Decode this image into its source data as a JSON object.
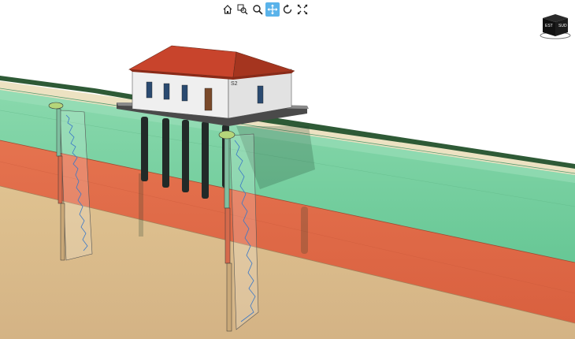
{
  "toolbar": {
    "tools": [
      {
        "name": "home",
        "icon": "home-icon",
        "active": false
      },
      {
        "name": "zoom-window",
        "icon": "zoom-window-icon",
        "active": false
      },
      {
        "name": "zoom",
        "icon": "magnifier-icon",
        "active": false
      },
      {
        "name": "pan",
        "icon": "move-arrows-icon",
        "active": true
      },
      {
        "name": "rotate",
        "icon": "rotate-icon",
        "active": false
      },
      {
        "name": "fit-extents",
        "icon": "expand-arrows-icon",
        "active": false
      }
    ],
    "active_color": "#5ab3ea"
  },
  "view_cube": {
    "face_labels": [
      "EST",
      "SUD"
    ]
  },
  "building": {
    "tag": "S2"
  },
  "colors": {
    "grass_strip": "#2e5a36",
    "ground_surface": "#ece2c2",
    "layer_green": "#6dce98",
    "layer_red": "#e06a48",
    "layer_tan": "#d9b98a",
    "roof": "#c8442c",
    "wall": "#efefef",
    "pile": "#222a28"
  }
}
